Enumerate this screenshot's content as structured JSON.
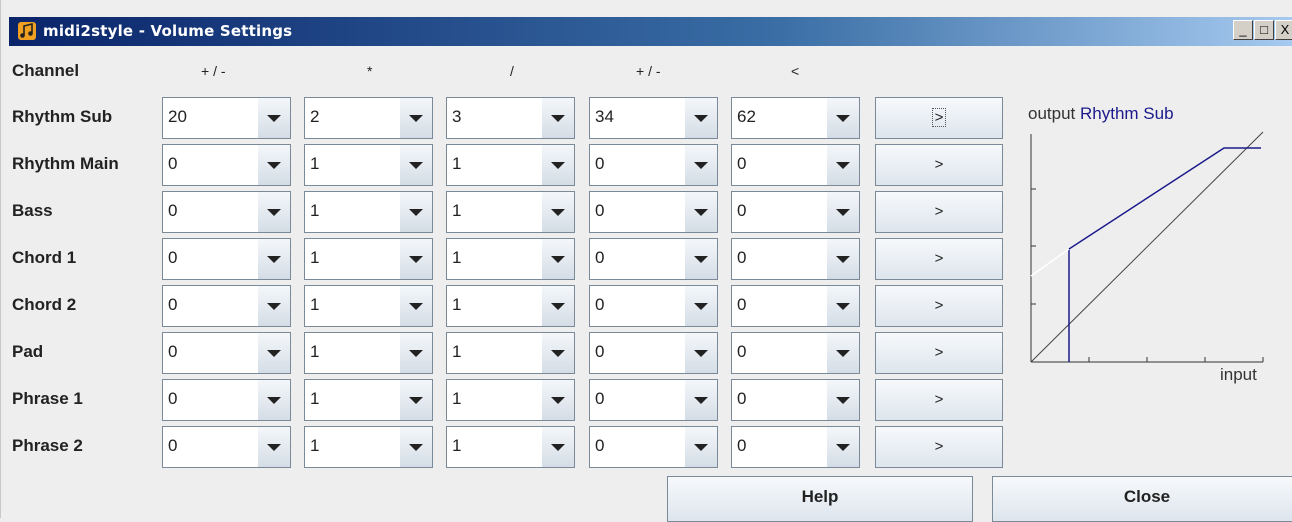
{
  "window": {
    "title": "midi2style - Volume Settings",
    "controls": [
      "_",
      "□",
      "X"
    ]
  },
  "headers": {
    "channel": "Channel",
    "columns": [
      "+ / -",
      "*",
      "/",
      "+ / -",
      "<"
    ]
  },
  "rows": [
    {
      "label": "Rhythm Sub",
      "values": [
        "20",
        "2",
        "3",
        "34",
        "62"
      ],
      "button": ">"
    },
    {
      "label": "Rhythm Main",
      "values": [
        "0",
        "1",
        "1",
        "0",
        "0"
      ],
      "button": ">"
    },
    {
      "label": "Bass",
      "values": [
        "0",
        "1",
        "1",
        "0",
        "0"
      ],
      "button": ">"
    },
    {
      "label": "Chord 1",
      "values": [
        "0",
        "1",
        "1",
        "0",
        "0"
      ],
      "button": ">"
    },
    {
      "label": "Chord 2",
      "values": [
        "0",
        "1",
        "1",
        "0",
        "0"
      ],
      "button": ">"
    },
    {
      "label": "Pad",
      "values": [
        "0",
        "1",
        "1",
        "0",
        "0"
      ],
      "button": ">"
    },
    {
      "label": "Phrase 1",
      "values": [
        "0",
        "1",
        "1",
        "0",
        "0"
      ],
      "button": ">"
    },
    {
      "label": "Phrase 2",
      "values": [
        "0",
        "1",
        "1",
        "0",
        "0"
      ],
      "button": ">"
    }
  ],
  "graph": {
    "title_prefix": "output",
    "selected_channel": "Rhythm Sub",
    "x_label": "input",
    "curve_color": "#1a1a8c"
  },
  "footer": {
    "help_label": "Help",
    "close_label": "Close"
  }
}
